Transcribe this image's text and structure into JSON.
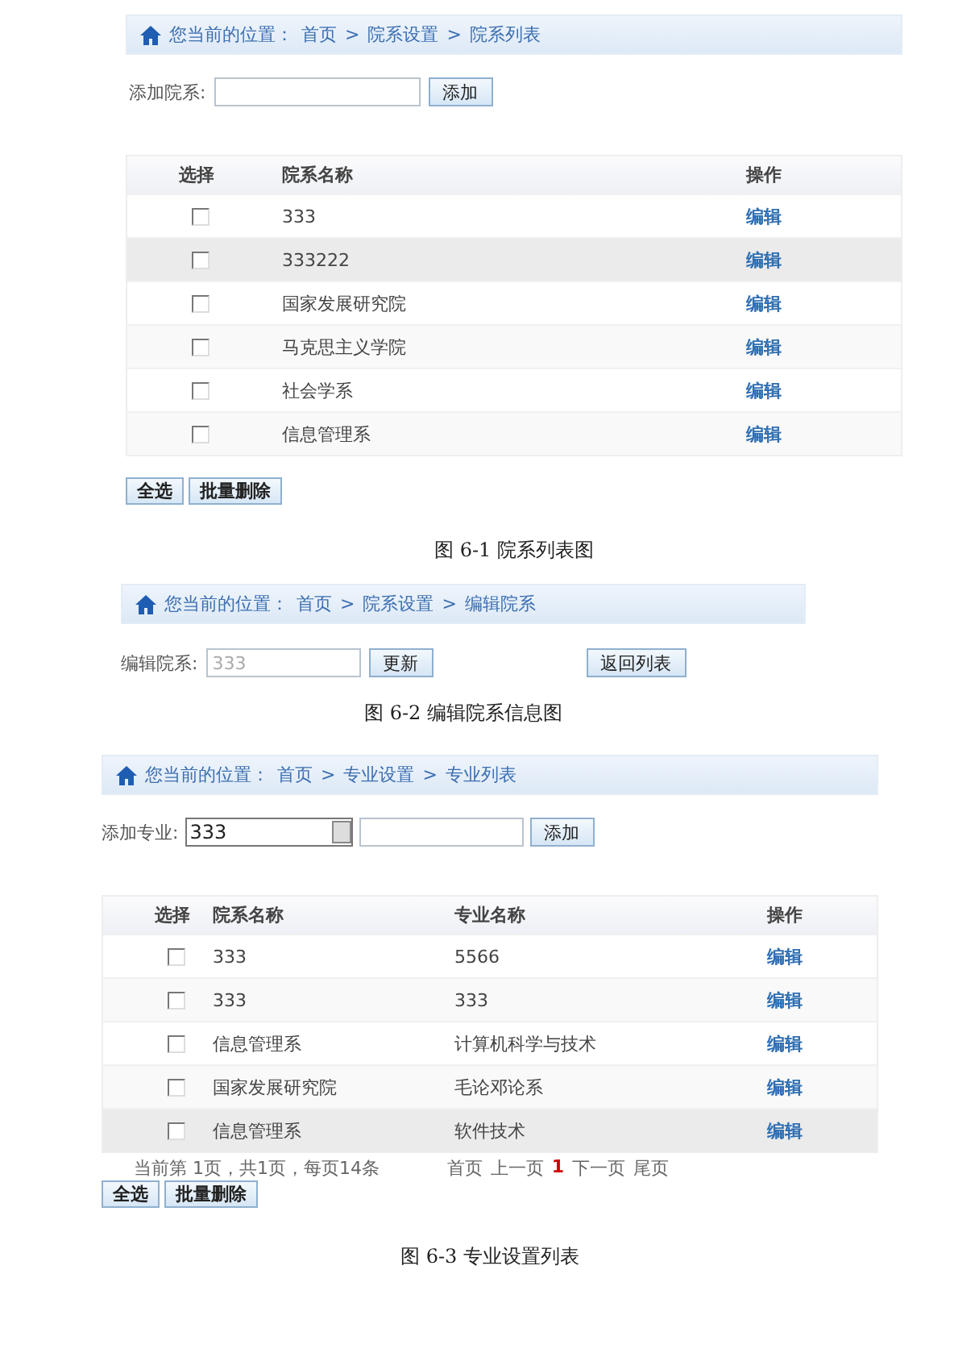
{
  "figure_1": {
    "breadcrumb": {
      "prefix": "您当前的位置：",
      "separator": ">",
      "items": [
        "首页",
        "院系设置",
        "院系列表"
      ]
    },
    "add_form": {
      "label": "添加院系:",
      "button": "添加"
    },
    "table": {
      "select_header": "选择",
      "columns": [
        "院系名称"
      ],
      "action_header": "操作",
      "rows": [
        {
          "checked": false,
          "highlighted": false,
          "cells": [
            "333"
          ],
          "action": "编辑"
        },
        {
          "checked": false,
          "highlighted": true,
          "cells": [
            "333222"
          ],
          "action": "编辑"
        },
        {
          "checked": false,
          "highlighted": false,
          "cells": [
            "国家发展研究院"
          ],
          "action": "编辑"
        },
        {
          "checked": false,
          "highlighted": false,
          "cells": [
            "马克思主义学院"
          ],
          "action": "编辑"
        },
        {
          "checked": false,
          "highlighted": false,
          "cells": [
            "社会学系"
          ],
          "action": "编辑"
        },
        {
          "checked": false,
          "highlighted": false,
          "cells": [
            "信息管理系"
          ],
          "action": "编辑"
        }
      ]
    },
    "buttons": [
      "全选",
      "批量删除"
    ],
    "caption": "图 6-1  院系列表图"
  },
  "figure_2": {
    "breadcrumb": {
      "prefix": "您当前的位置：",
      "separator": ">",
      "items": [
        "首页",
        "院系设置",
        "编辑院系"
      ]
    },
    "edit_form": {
      "label": "编辑院系:",
      "value": "333",
      "update_button": "更新",
      "back_button": "返回列表"
    },
    "caption": "图 6-2  编辑院系信息图"
  },
  "figure_3": {
    "breadcrumb": {
      "prefix": "您当前的位置：",
      "separator": ">",
      "items": [
        "首页",
        "专业设置",
        "专业列表"
      ]
    },
    "add_form": {
      "label": "添加专业:",
      "select_value": "333",
      "button": "添加"
    },
    "table": {
      "select_header": "选择",
      "columns": [
        "院系名称",
        "专业名称"
      ],
      "action_header": "操作",
      "rows": [
        {
          "checked": false,
          "highlighted": false,
          "cells": [
            "333",
            "5566"
          ],
          "action": "编辑"
        },
        {
          "checked": false,
          "highlighted": false,
          "cells": [
            "333",
            "333"
          ],
          "action": "编辑"
        },
        {
          "checked": false,
          "highlighted": false,
          "cells": [
            "信息管理系",
            "计算机科学与技术"
          ],
          "action": "编辑"
        },
        {
          "checked": false,
          "highlighted": false,
          "cells": [
            "国家发展研究院",
            "毛论邓论系"
          ],
          "action": "编辑"
        },
        {
          "checked": false,
          "highlighted": true,
          "cells": [
            "信息管理系",
            "软件技术"
          ],
          "action": "编辑"
        }
      ]
    },
    "pager": {
      "info": "当前第 1页，共1页，每页14条",
      "links": [
        {
          "label": "首页",
          "selected": false
        },
        {
          "label": "上一页",
          "selected": false
        },
        {
          "label": "1",
          "selected": true
        },
        {
          "label": "下一页",
          "selected": false
        },
        {
          "label": "尾页",
          "selected": false
        }
      ]
    },
    "buttons": [
      "全选",
      "批量删除"
    ],
    "caption": "图 6-3  专业设置列表"
  }
}
